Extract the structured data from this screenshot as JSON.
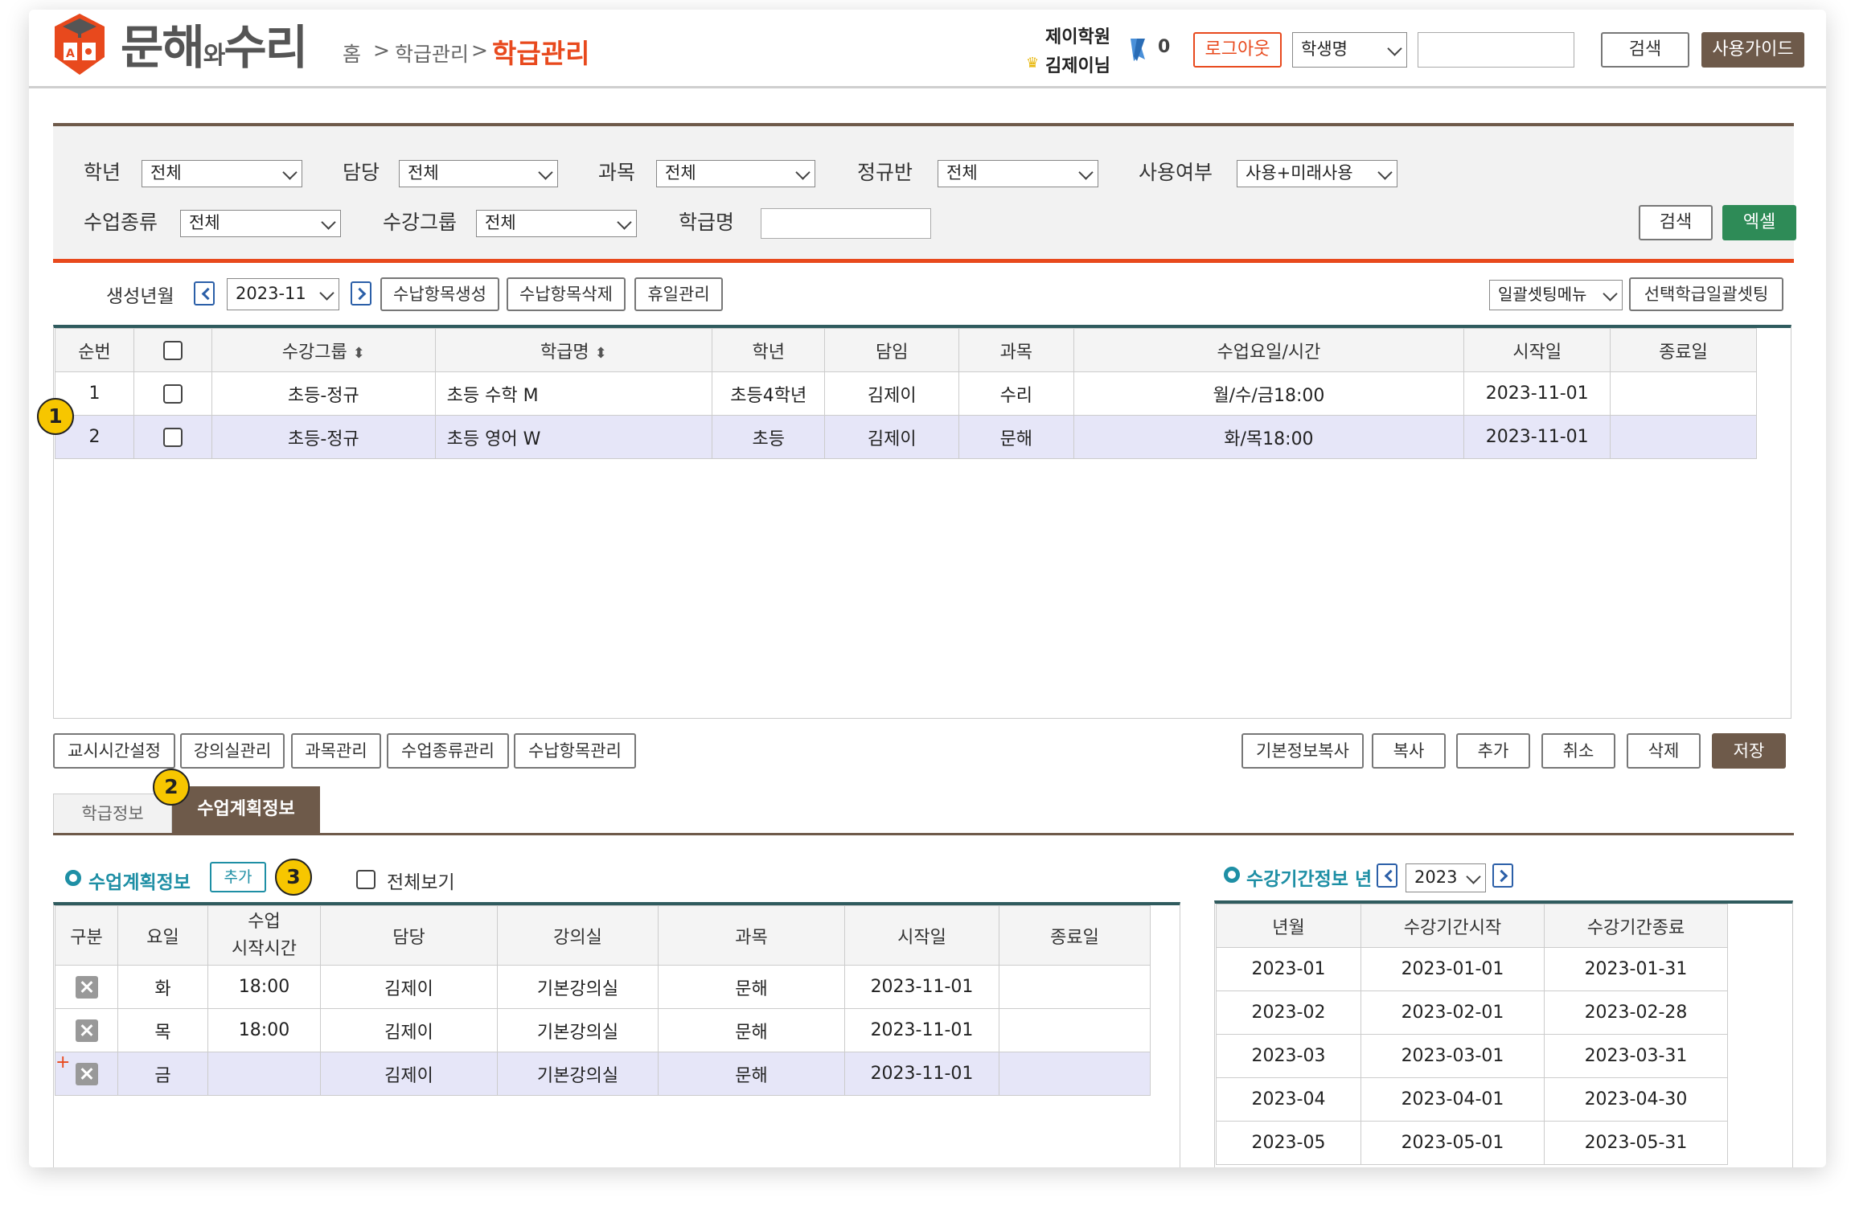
{
  "header": {
    "logo_main": "문해",
    "logo_wa": "와",
    "logo_end": "수리",
    "breadcrumb": [
      "홈",
      "학급관리"
    ],
    "breadcrumb_sep": ">",
    "current_page": "학급관리",
    "academy": "제이학원",
    "user": "김제이님",
    "points": "0",
    "logout": "로그아웃",
    "search_type": "학생명",
    "search_value": "",
    "search": "검색",
    "guide": "사용가이드"
  },
  "filters": {
    "grade_label": "학년",
    "grade": "전체",
    "teacher_label": "담당",
    "teacher": "전체",
    "subject_label": "과목",
    "subject": "전체",
    "regular_label": "정규반",
    "regular": "전체",
    "use_label": "사용여부",
    "use": "사용+미래사용",
    "lesson_type_label": "수업종류",
    "lesson_type": "전체",
    "group_label": "수강그룹",
    "group": "전체",
    "class_name_label": "학급명",
    "class_name": "",
    "search": "검색",
    "excel": "엑셀"
  },
  "toolbar": {
    "month_label": "생성년월",
    "month": "2023-11",
    "create_fee": "수납항목생성",
    "delete_fee": "수납항목삭제",
    "holiday": "휴일관리",
    "batch_menu": "일괄셋팅메뉴",
    "batch_selected": "선택학급일괄셋팅"
  },
  "class_grid": {
    "headers": [
      "순번",
      "",
      "수강그룹",
      "학급명",
      "학년",
      "담임",
      "과목",
      "수업요일/시간",
      "시작일",
      "종료일"
    ],
    "rows": [
      {
        "no": "1",
        "group": "초등-정규",
        "name": "초등 수학 M",
        "grade": "초등4학년",
        "teacher": "김제이",
        "subject": "수리",
        "schedule": "월/수/금18:00",
        "start": "2023-11-01",
        "end": ""
      },
      {
        "no": "2",
        "group": "초등-정규",
        "name": "초등 영어 W",
        "grade": "초등",
        "teacher": "김제이",
        "subject": "문해",
        "schedule": "화/목18:00",
        "start": "2023-11-01",
        "end": ""
      }
    ]
  },
  "bottom_buttons_left": [
    "교시시간설정",
    "강의실관리",
    "과목관리",
    "수업종류관리",
    "수납항목관리"
  ],
  "bottom_buttons_right": [
    "기본정보복사",
    "복사",
    "추가",
    "취소",
    "삭제",
    "저장"
  ],
  "badges": [
    "1",
    "2",
    "3"
  ],
  "tabs": [
    "학급정보",
    "수업계획정보"
  ],
  "plan": {
    "title": "수업계획정보",
    "add": "추가",
    "show_all": "전체보기",
    "headers": [
      "구분",
      "요일",
      "수업\n시작시간",
      "담당",
      "강의실",
      "과목",
      "시작일",
      "종료일"
    ],
    "rows": [
      {
        "day": "화",
        "time": "18:00",
        "teacher": "김제이",
        "room": "기본강의실",
        "subject": "문해",
        "start": "2023-11-01",
        "end": ""
      },
      {
        "day": "목",
        "time": "18:00",
        "teacher": "김제이",
        "room": "기본강의실",
        "subject": "문해",
        "start": "2023-11-01",
        "end": ""
      },
      {
        "day": "금",
        "time": "",
        "teacher": "김제이",
        "room": "기본강의실",
        "subject": "문해",
        "start": "2023-11-01",
        "end": ""
      }
    ]
  },
  "period": {
    "title": "수강기간정보 년",
    "year": "2023",
    "headers": [
      "년월",
      "수강기간시작",
      "수강기간종료"
    ],
    "rows": [
      {
        "ym": "2023-01",
        "start": "2023-01-01",
        "end": "2023-01-31"
      },
      {
        "ym": "2023-02",
        "start": "2023-02-01",
        "end": "2023-02-28"
      },
      {
        "ym": "2023-03",
        "start": "2023-03-01",
        "end": "2023-03-31"
      },
      {
        "ym": "2023-04",
        "start": "2023-04-01",
        "end": "2023-04-30"
      },
      {
        "ym": "2023-05",
        "start": "2023-05-01",
        "end": "2023-05-31"
      }
    ]
  },
  "colors": {
    "accent": "#e8491d",
    "brown": "#6e5a4a",
    "green": "#2e8b57",
    "teal": "#1e8fa5",
    "badge": "#f7c600"
  }
}
